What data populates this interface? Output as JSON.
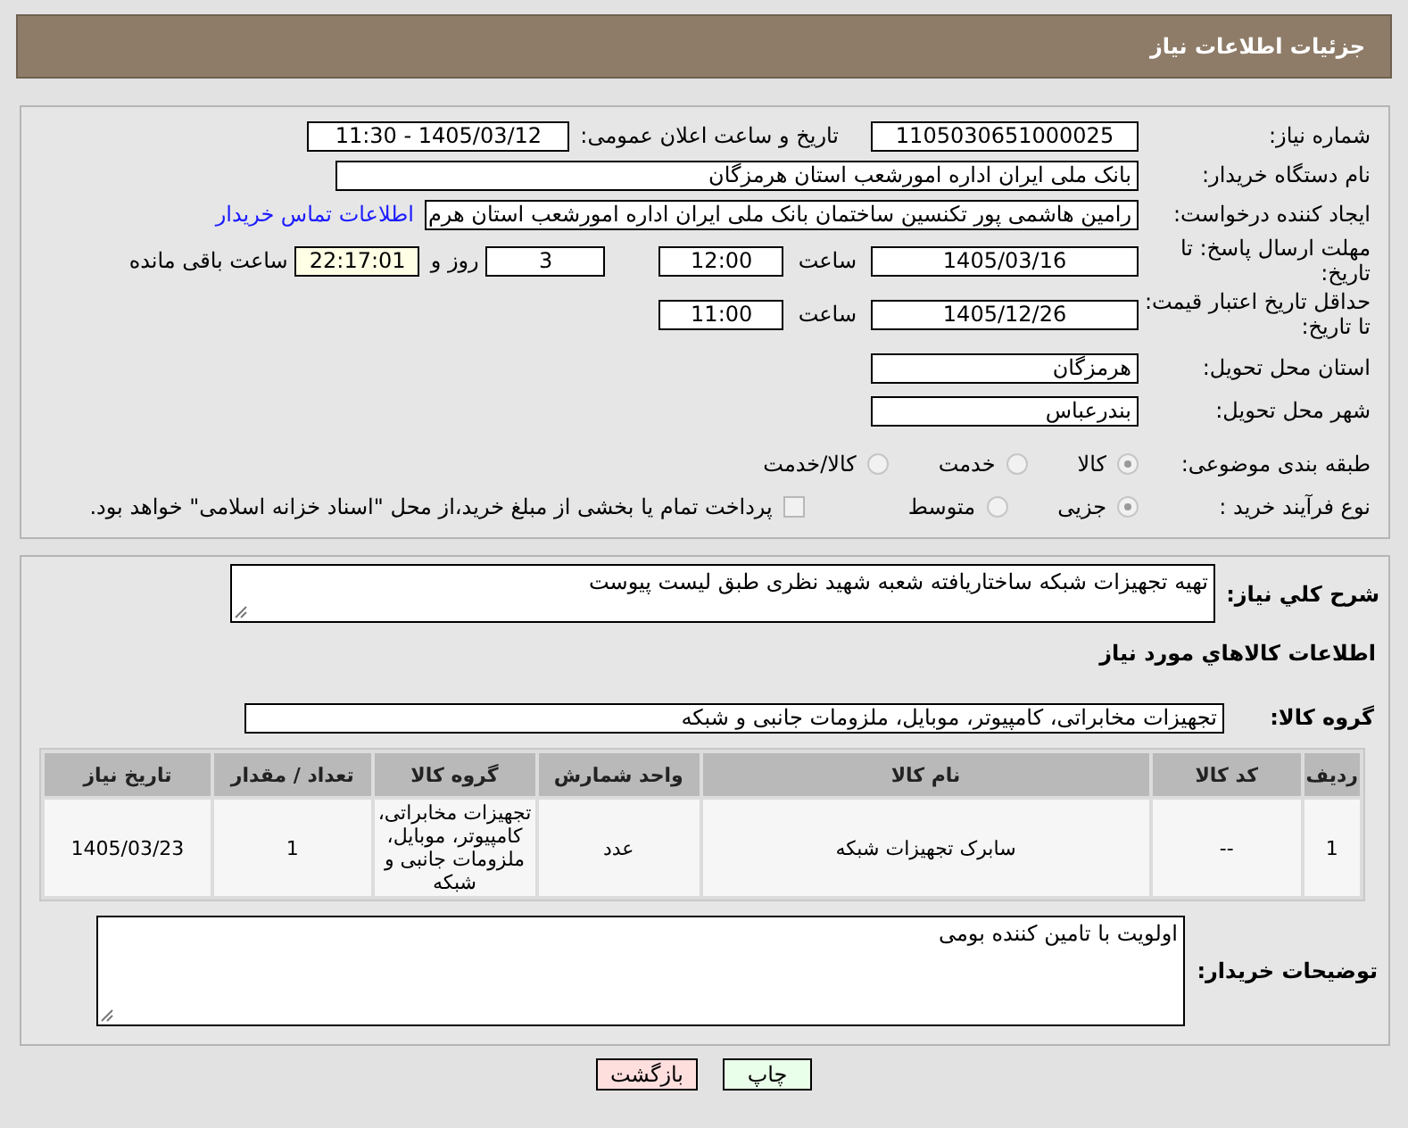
{
  "header": {
    "title": "جزئیات اطلاعات نیاز"
  },
  "need_number": {
    "label": "شماره نیاز:",
    "value": "1105030651000025"
  },
  "announce": {
    "label": "تاریخ و ساعت اعلان عمومی:",
    "value": "1405/03/12 - 11:30"
  },
  "buyer": {
    "label": "نام دستگاه خریدار:",
    "value": "بانک ملی ایران اداره امورشعب استان هرمزگان"
  },
  "requester": {
    "label": "ایجاد کننده درخواست:",
    "value": "رامین هاشمی پور تکنسین ساختمان بانک ملی ایران اداره امورشعب استان هرم",
    "link": "اطلاعات تماس خریدار"
  },
  "deadline": {
    "label": "مهلت ارسال پاسخ: تا تاریخ:",
    "date": "1405/03/16",
    "time_label": "ساعت",
    "time": "12:00",
    "days": "3",
    "days_label": "روز و",
    "remaining": "22:17:01",
    "remaining_label": "ساعت باقی مانده"
  },
  "validity": {
    "label": "حداقل تاریخ اعتبار قیمت: تا تاریخ:",
    "date": "1405/12/26",
    "time_label": "ساعت",
    "time": "11:00"
  },
  "province": {
    "label": "استان محل تحویل:",
    "value": "هرمزگان"
  },
  "city": {
    "label": "شهر محل تحویل:",
    "value": "بندرعباس"
  },
  "category": {
    "label": "طبقه بندی موضوعی:",
    "options": [
      {
        "label": "کالا",
        "selected": true
      },
      {
        "label": "خدمت",
        "selected": false
      },
      {
        "label": "کالا/خدمت",
        "selected": false
      }
    ]
  },
  "process": {
    "label": "نوع فرآیند خرید :",
    "options": [
      {
        "label": "جزیی",
        "selected": true
      },
      {
        "label": "متوسط",
        "selected": false
      }
    ],
    "payment": {
      "label": "پرداخت تمام یا بخشی از مبلغ خرید،از محل \"اسناد خزانه اسلامی\" خواهد بود.",
      "checked": false
    }
  },
  "description": {
    "label": "شرح کلي نياز:",
    "value": "تهیه تجهیزات شبکه ساختاریافته شعبه شهید نظری طبق لیست پیوست"
  },
  "goods_title": "اطلاعات کالاهاي مورد نياز",
  "goods_group": {
    "label": "گروه کالا:",
    "value": "تجهیزات مخابراتی، کامپیوتر، موبایل، ملزومات جانبی و شبکه"
  },
  "table": {
    "columns": [
      "ردیف",
      "کد کالا",
      "نام کالا",
      "واحد شمارش",
      "گروه کالا",
      "تعداد / مقدار",
      "تاریخ نیاز"
    ],
    "rows": [
      [
        "1",
        "--",
        "سابرک تجهیزات شبکه",
        "عدد",
        "تجهیزات مخابراتی، کامپیوتر، موبایل، ملزومات جانبی و شبکه",
        "1",
        "1405/03/23"
      ]
    ]
  },
  "buyer_notes": {
    "label": "توضیحات خریدار:",
    "value": "اولویت با تامین کننده بومی"
  },
  "buttons": [
    {
      "label": "چاپ",
      "kind": "print"
    },
    {
      "label": "بازگشت",
      "kind": "back"
    }
  ]
}
